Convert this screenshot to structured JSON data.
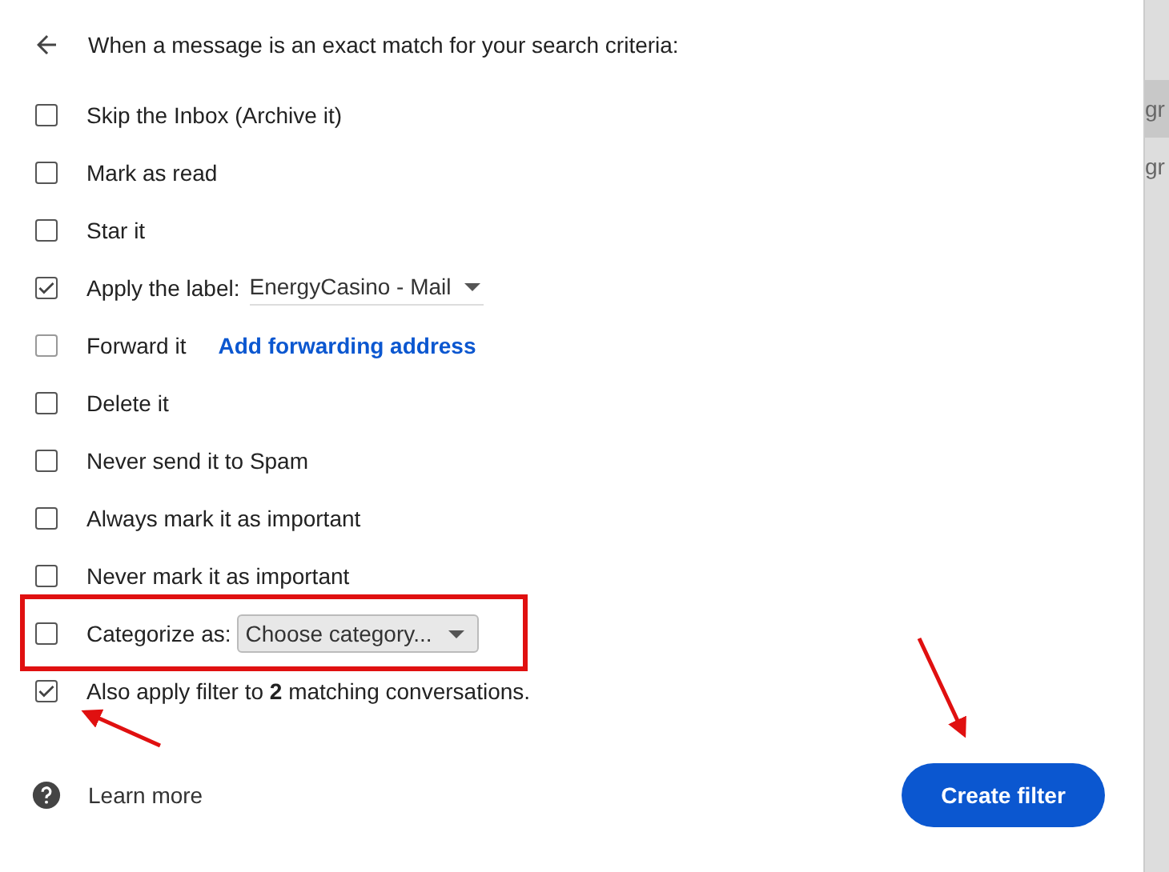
{
  "header": {
    "title": "When a message is an exact match for your search criteria:"
  },
  "options": [
    {
      "kind": "plain",
      "label": "Skip the Inbox (Archive it)",
      "checked": false,
      "disabled": false
    },
    {
      "kind": "plain",
      "label": "Mark as read",
      "checked": false,
      "disabled": false
    },
    {
      "kind": "plain",
      "label": "Star it",
      "checked": false,
      "disabled": false
    },
    {
      "kind": "label_select",
      "label": "Apply the label:",
      "value": "EnergyCasino - Mail",
      "checked": true,
      "disabled": false
    },
    {
      "kind": "link",
      "label": "Forward it",
      "link": "Add forwarding address",
      "checked": false,
      "disabled": true
    },
    {
      "kind": "plain",
      "label": "Delete it",
      "checked": false,
      "disabled": false
    },
    {
      "kind": "plain",
      "label": "Never send it to Spam",
      "checked": false,
      "disabled": false
    },
    {
      "kind": "plain",
      "label": "Always mark it as important",
      "checked": false,
      "disabled": false
    },
    {
      "kind": "plain",
      "label": "Never mark it as important",
      "checked": false,
      "disabled": false
    },
    {
      "kind": "category_select",
      "label": "Categorize as:",
      "value": "Choose category...",
      "checked": false,
      "disabled": false
    },
    {
      "kind": "rich",
      "label": "Also apply filter to **2** matching conversations.",
      "checked": true,
      "disabled": false
    }
  ],
  "footer": {
    "learn_more": "Learn more",
    "create_button": "Create filter"
  },
  "background": {
    "texts": [
      "gr",
      "gr"
    ]
  }
}
